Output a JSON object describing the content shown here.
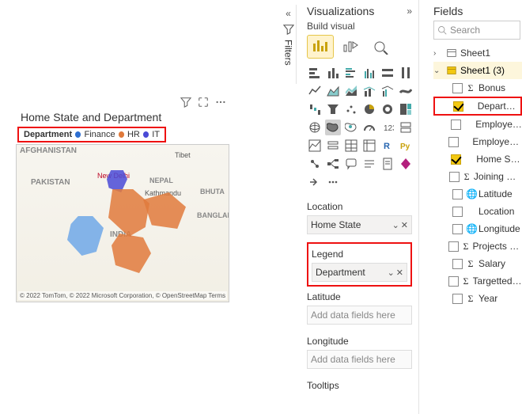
{
  "visual": {
    "title": "Home State and Department",
    "legend_label": "Department",
    "legend_items": [
      {
        "name": "Finance",
        "color": "#2e6fd1"
      },
      {
        "name": "HR",
        "color": "#e07a3c"
      },
      {
        "name": "IT",
        "color": "#4a4ad6"
      }
    ],
    "map_labels": {
      "afghanistan": "AFGHANISTAN",
      "pakistan": "PAKISTAN",
      "india": "INDIA",
      "nepal": "NEPAL",
      "bhutan": "BHUTA",
      "bangladesh": "BANGLAI",
      "tibet": "Tibet",
      "new_delhi": "New Delhi",
      "kathmandu": "Kathmandu"
    },
    "attribution": "© 2022 TomTom, © 2022 Microsoft Corporation, © OpenStreetMap  Terms"
  },
  "filters_tab": {
    "label": "Filters"
  },
  "viz_pane": {
    "title": "Visualizations",
    "subtitle": "Build visual",
    "wells": {
      "location_label": "Location",
      "location_value": "Home State",
      "legend_label": "Legend",
      "legend_value": "Department",
      "latitude_label": "Latitude",
      "latitude_placeholder": "Add data fields here",
      "longitude_label": "Longitude",
      "longitude_placeholder": "Add data fields here",
      "tooltips_label": "Tooltips"
    }
  },
  "fields_pane": {
    "title": "Fields",
    "search_placeholder": "Search",
    "tables": [
      {
        "name": "Sheet1",
        "expanded": false,
        "highlighted": false
      },
      {
        "name": "Sheet1 (3)",
        "expanded": true,
        "highlighted": true
      }
    ],
    "fields": [
      {
        "name": "Bonus",
        "checked": false,
        "sigma": true
      },
      {
        "name": "Department",
        "checked": true,
        "sigma": false,
        "highlighted": true
      },
      {
        "name": "Employee Id",
        "checked": false,
        "sigma": false
      },
      {
        "name": "Employee Nam",
        "checked": false,
        "sigma": false
      },
      {
        "name": "Home State",
        "checked": true,
        "sigma": false
      },
      {
        "name": "Joining Bonus",
        "checked": false,
        "sigma": true
      },
      {
        "name": "Latitude",
        "checked": false,
        "sigma": false,
        "icon": "globe"
      },
      {
        "name": "Location",
        "checked": false,
        "sigma": false
      },
      {
        "name": "Longitude",
        "checked": false,
        "sigma": false,
        "icon": "globe"
      },
      {
        "name": "Projects Compl",
        "checked": false,
        "sigma": true
      },
      {
        "name": "Salary",
        "checked": false,
        "sigma": true
      },
      {
        "name": "Targetted Proje",
        "checked": false,
        "sigma": true
      },
      {
        "name": "Year",
        "checked": false,
        "sigma": true
      }
    ]
  }
}
